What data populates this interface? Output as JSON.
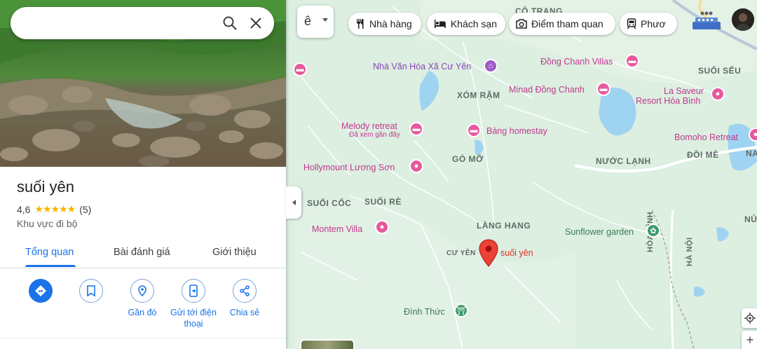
{
  "search": {
    "value": "",
    "placeholder": ""
  },
  "place": {
    "name": "suối yên",
    "rating": "4,6",
    "stars": "★★★★★",
    "review_count": "(5)",
    "category": "Khu vực đi bộ"
  },
  "tabs": [
    {
      "label": "Tổng quan",
      "active": true
    },
    {
      "label": "Bài đánh giá",
      "active": false
    },
    {
      "label": "Giới thiệu",
      "active": false
    }
  ],
  "actions": [
    {
      "label": "",
      "icon": "directions-icon"
    },
    {
      "label": "",
      "icon": "bookmark-icon"
    },
    {
      "label": "Gần đó",
      "icon": "nearby-icon"
    },
    {
      "label": "Gửi tới điện thoại",
      "icon": "send-to-phone-icon"
    },
    {
      "label": "Chia sẻ",
      "icon": "share-icon"
    }
  ],
  "layer_button": {
    "glyph": "ê"
  },
  "chips": [
    {
      "label": "Nhà hàng",
      "icon": "restaurant-icon"
    },
    {
      "label": "Khách sạn",
      "icon": "hotel-icon"
    },
    {
      "label": "Điểm tham quan",
      "icon": "camera-icon"
    },
    {
      "label": "Phươ",
      "icon": "transit-icon"
    }
  ],
  "map": {
    "areas": {
      "co_trang": "CÔ TRANG",
      "xom_ram": "XÓM RẶM",
      "suoi_seu": "SUỐI SẾU",
      "go_mo": "GÒ MỠ",
      "nuoc_lanh": "NƯỚC LẠNH",
      "doi_me": "ĐỒI MÈ",
      "suoi_coc": "SUỐI CỐC",
      "suoi_re": "SUỐI RÈ",
      "lang_hang": "LÀNG HANG",
      "cu_yen": "CƯ YÊN",
      "hoa_binh": "HÒA BÌNH",
      "ha_noi": "HÀ NỘI",
      "na": "NA",
      "nu": "NỦ"
    },
    "pois": {
      "nha_van_hoa": "Nhà Văn Hóa Xã Cư Yên",
      "dong_chanh": "Đồng Chanh Villas",
      "minad": "Minad Đồng Chanh",
      "la_saveur_1": "La Saveur",
      "la_saveur_2": "Resort Hòa Bình",
      "melody": "Melody retreat",
      "melody_sub": "Đã xem gần đây",
      "bang": "Bàng homestay",
      "bomoho": "Bomoho Retreat",
      "hollymount": "Hollymount Lương Sơn",
      "montem": "Montem Villa",
      "sunflower": "Sunflower garden",
      "dinh_thuc": "Đình Thức",
      "selected": "suối yên"
    }
  },
  "zoom_in_label": "+"
}
